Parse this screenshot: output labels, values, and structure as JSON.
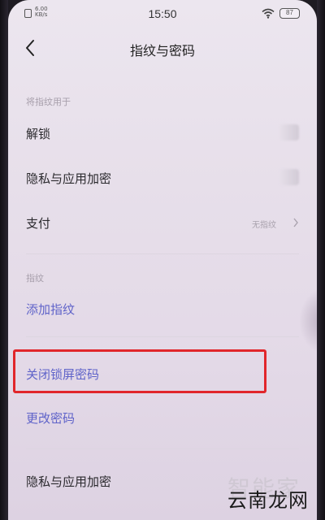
{
  "status_bar": {
    "speed_value": "6.00",
    "speed_unit": "KB/s",
    "time": "15:50",
    "battery": "87"
  },
  "header": {
    "title": "指纹与密码"
  },
  "section_use": {
    "label": "将指纹用于",
    "items": [
      {
        "label": "解锁"
      },
      {
        "label": "隐私与应用加密"
      },
      {
        "label": "支付",
        "value": "无指纹"
      }
    ]
  },
  "section_fingerprint": {
    "label": "指纹",
    "add_label": "添加指纹"
  },
  "password": {
    "close_label": "关闭锁屏密码",
    "change_label": "更改密码"
  },
  "bottom_item": {
    "label": "隐私与应用加密"
  },
  "watermark": {
    "top": "智能家",
    "main": "云南龙网"
  },
  "colors": {
    "link": "#5f63c9",
    "highlight": "#e1262b",
    "background": "#e7dfea"
  }
}
